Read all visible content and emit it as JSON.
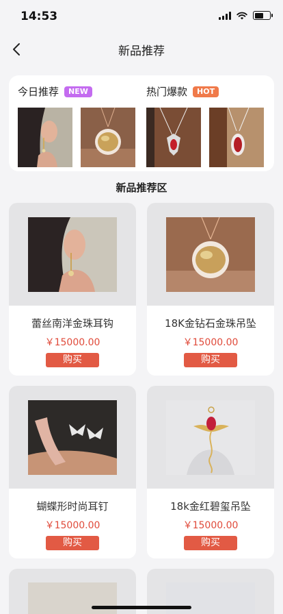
{
  "status": {
    "time": "14:53"
  },
  "nav": {
    "title": "新品推荐"
  },
  "sections": {
    "today": {
      "label": "今日推荐",
      "badge": "NEW"
    },
    "hot": {
      "label": "热门爆款",
      "badge": "HOT"
    }
  },
  "zone": {
    "title": "新品推荐区"
  },
  "products": [
    {
      "name": "蕾丝南洋金珠耳钩",
      "price": "￥15000.00",
      "buy": "购买"
    },
    {
      "name": "18K金钻石金珠吊坠",
      "price": "￥15000.00",
      "buy": "购买"
    },
    {
      "name": "蝴蝶形时尚耳钉",
      "price": "￥15000.00",
      "buy": "购买"
    },
    {
      "name": "18k金红碧玺吊坠",
      "price": "￥15000.00",
      "buy": "购买"
    }
  ],
  "colors": {
    "accent": "#e25a44",
    "price": "#e04a3a",
    "new_badge": "#c46cf0",
    "hot_badge": "#f07a4a"
  },
  "icons": [
    "back-arrow-icon",
    "signal-icon",
    "wifi-icon",
    "battery-icon"
  ],
  "battery_level": 0.6
}
